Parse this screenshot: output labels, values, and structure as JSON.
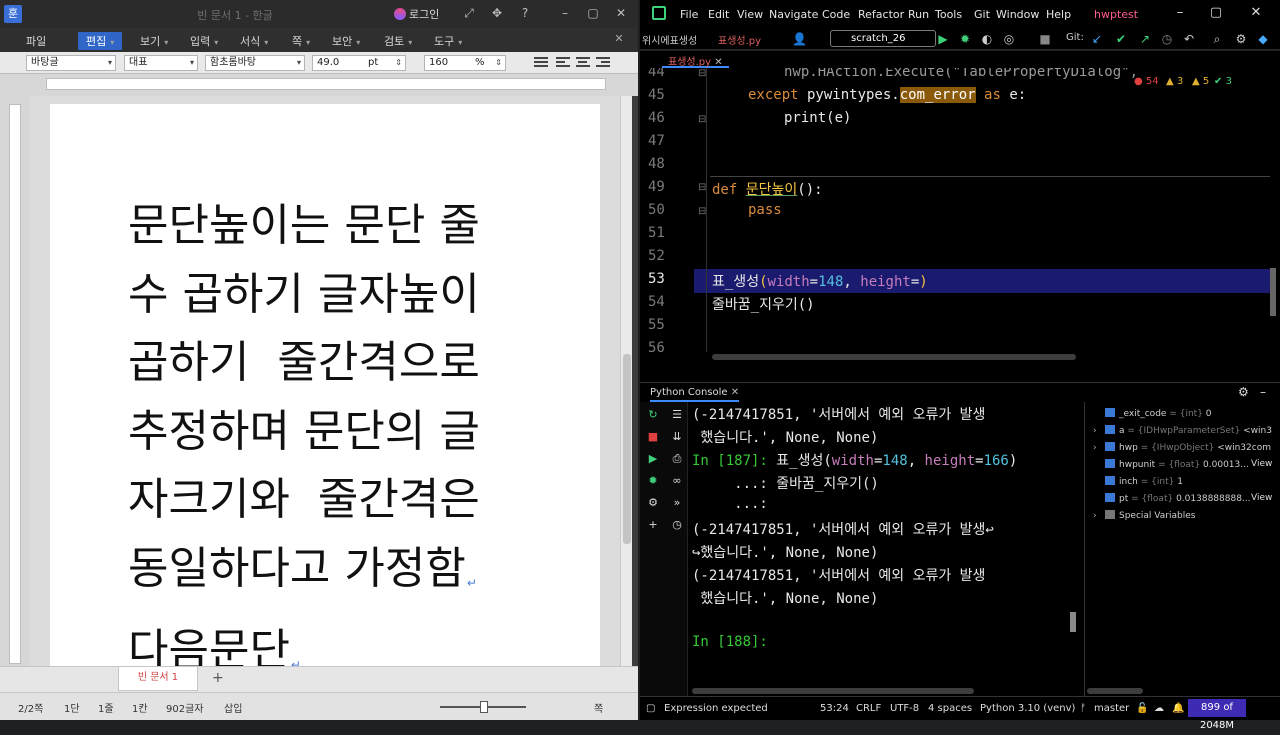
{
  "hwp": {
    "title": "빈 문서 1 - 한글",
    "login": "로그인",
    "menu": [
      {
        "label": "파일"
      },
      {
        "label": "편집"
      },
      {
        "label": "보기"
      },
      {
        "label": "입력"
      },
      {
        "label": "서식"
      },
      {
        "label": "쪽"
      },
      {
        "label": "보안"
      },
      {
        "label": "검토"
      },
      {
        "label": "도구"
      }
    ],
    "format": {
      "style": "바탕글",
      "lang": "대표",
      "font": "함초롬바탕",
      "size": "49.0",
      "size_unit": "pt",
      "spacing": "160",
      "spacing_unit": "%"
    },
    "document_lines": [
      "문단높이는 문단 줄",
      "수 곱하기 글자높이",
      "곱하기  줄간격으로",
      "추정하며 문단의 글",
      "자크기와  줄간격은",
      "동일하다고 가정함",
      "다음문단"
    ],
    "tab_label": "빈 문서 1",
    "status": {
      "page": "2/2쪽",
      "section": "1단",
      "line": "1줄",
      "col": "1칸",
      "chars": "902글자",
      "mode": "삽입",
      "zoom": "쪽"
    }
  },
  "ide": {
    "menu": [
      "File",
      "Edit",
      "View",
      "Navigate",
      "Code",
      "Refactor",
      "Run",
      "Tools",
      "Git",
      "Window",
      "Help"
    ],
    "project": "hwptest",
    "breadcrumb": "위시에표생성",
    "breadcrumb_file": "표생성.py",
    "run_config": "scratch_26",
    "git_label": "Git:",
    "tab": "표생성.py",
    "inspections": {
      "errors": "54",
      "warnings": "3",
      "weak": "5",
      "ok": "3"
    },
    "editor_lines": [
      {
        "n": "44",
        "text": "hwp.HAction.Execute(\"TablePropertyDialog\", "
      },
      {
        "n": "45",
        "text": "except pywintypes.com_error as e:"
      },
      {
        "n": "46",
        "text": "print(e)"
      },
      {
        "n": "47",
        "text": ""
      },
      {
        "n": "48",
        "text": ""
      },
      {
        "n": "49",
        "text": "def 문단높이():"
      },
      {
        "n": "50",
        "text": "pass"
      },
      {
        "n": "51",
        "text": ""
      },
      {
        "n": "52",
        "text": ""
      },
      {
        "n": "53",
        "text": "표_생성(width=148, height=)"
      },
      {
        "n": "54",
        "text": "줄바꿈_지우기()"
      },
      {
        "n": "55",
        "text": ""
      },
      {
        "n": "56",
        "text": ""
      }
    ],
    "console_title": "Python Console",
    "console_lines": [
      "(-2147417851, '서버에서 예외 오류가 발생",
      " 했습니다.', None, None)",
      "In [187]: 표_생성(width=148, height=166)",
      "     ...: 줄바꿈_지우기()",
      "     ...:",
      "(-2147417851, '서버에서 예외 오류가 발생↩",
      "↪했습니다.', None, None)",
      "(-2147417851, '서버에서 예외 오류가 발생",
      " 했습니다.', None, None)",
      "",
      "In [188]:"
    ],
    "variables": [
      {
        "name": "_exit_code",
        "type": "{int}",
        "value": "0"
      },
      {
        "name": "a",
        "type": "{IDHwpParameterSet}",
        "value": "<win3"
      },
      {
        "name": "hwp",
        "type": "{IHwpObject}",
        "value": "<win32com"
      },
      {
        "name": "hwpunit",
        "type": "{float}",
        "value": "0.00013..."
      },
      {
        "name": "inch",
        "type": "{int}",
        "value": "1"
      },
      {
        "name": "pt",
        "type": "{float}",
        "value": "0.0138888888..."
      },
      {
        "name": "Special Variables",
        "type": "",
        "value": ""
      }
    ],
    "view_label": "View",
    "status": {
      "message": "Expression expected",
      "position": "53:24",
      "line_sep": "CRLF",
      "encoding": "UTF-8",
      "indent": "4 spaces",
      "interpreter": "Python 3.10 (venv)",
      "branch": "master",
      "memory": "899 of 2048M"
    }
  }
}
